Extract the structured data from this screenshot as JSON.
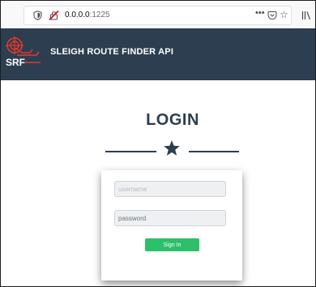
{
  "browser": {
    "url_host": "0.0.0.0",
    "url_port": ":1225",
    "icons": {
      "more": "more-actions-icon",
      "pocket": "pocket-icon",
      "bookmark": "bookmark-star-icon",
      "library": "library-icon",
      "shield": "tracking-protection-shield-icon",
      "insecure": "insecure-connection-icon"
    }
  },
  "header": {
    "title": "SLEIGH ROUTE FINDER API",
    "logo_text": "SRF",
    "background_color": "#2c3e50"
  },
  "login": {
    "heading": "LOGIN",
    "divider_icon": "star-icon",
    "username_placeholder": "username",
    "password_placeholder": "password",
    "submit_label": "Sign In",
    "accent_color": "#2ebf6b"
  }
}
